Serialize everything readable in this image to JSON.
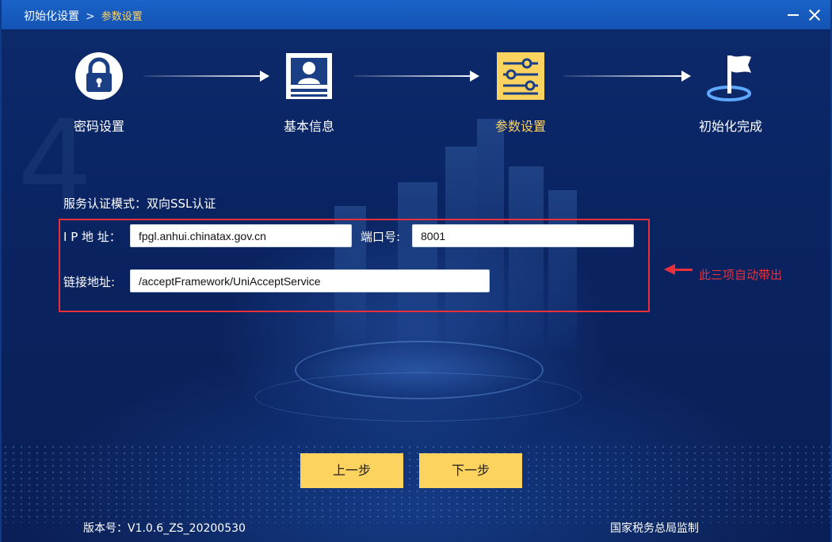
{
  "window": {
    "breadcrumb_root": "初始化设置",
    "breadcrumb_sep": ">",
    "breadcrumb_current": "参数设置",
    "controls": [
      "minimize-icon",
      "close-icon"
    ]
  },
  "steps": [
    {
      "label": "密码设置",
      "icon": "lock-icon",
      "active": false
    },
    {
      "label": "基本信息",
      "icon": "id-card-icon",
      "active": false
    },
    {
      "label": "参数设置",
      "icon": "sliders-icon",
      "active": true
    },
    {
      "label": "初始化完成",
      "icon": "flag-icon",
      "active": false
    }
  ],
  "form": {
    "mode_text": "服务认证模式：双向SSL认证",
    "ip_label": "I P 地 址：",
    "ip_value": "fpgl.anhui.chinatax.gov.cn",
    "port_label": "端口号:",
    "port_value": "8001",
    "link_label": "链接地址:",
    "link_value": "/acceptFramework/UniAcceptService"
  },
  "annotation": {
    "text": "此三项自动带出",
    "color": "#e8303a"
  },
  "buttons": {
    "prev": "上一步",
    "next": "下一步"
  },
  "footer": {
    "version": "版本号：V1.0.6_ZS_20200530",
    "supervision": "国家税务总局监制"
  },
  "colors": {
    "accent": "#fdd360",
    "active_step": "#ffd45e",
    "title_bar": "#1a62c8",
    "background": "#0a2462"
  }
}
